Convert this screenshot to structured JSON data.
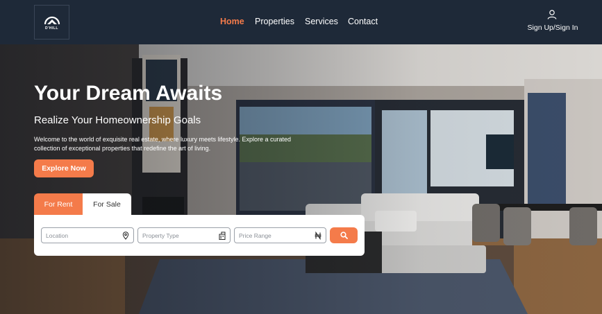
{
  "brand": {
    "logo_text": "D'HILL"
  },
  "nav": {
    "items": [
      {
        "label": "Home",
        "active": true
      },
      {
        "label": "Properties",
        "active": false
      },
      {
        "label": "Services",
        "active": false
      },
      {
        "label": "Contact",
        "active": false
      }
    ]
  },
  "auth": {
    "label": "Sign Up/Sign In",
    "icon": "user-icon"
  },
  "hero": {
    "title": "Your Dream Awaits",
    "subtitle": "Realize Your Homeownership Goals",
    "description": "Welcome to the world of exquisite real estate, where luxury meets lifestyle. Explore a curated collection of exceptional properties that redefine the art of living.",
    "cta_label": "Explore Now"
  },
  "search": {
    "tabs": [
      {
        "label": "For Rent",
        "active": true
      },
      {
        "label": "For Sale",
        "active": false
      }
    ],
    "fields": [
      {
        "placeholder": "Location",
        "icon": "map-pin-icon"
      },
      {
        "placeholder": "Property Type",
        "icon": "building-icon"
      },
      {
        "placeholder": "Price Range",
        "icon": "naira-icon"
      }
    ],
    "button_icon": "search-icon"
  },
  "colors": {
    "accent": "#f47b4a",
    "header_bg": "#1e2938",
    "text_light": "#ffffff"
  }
}
